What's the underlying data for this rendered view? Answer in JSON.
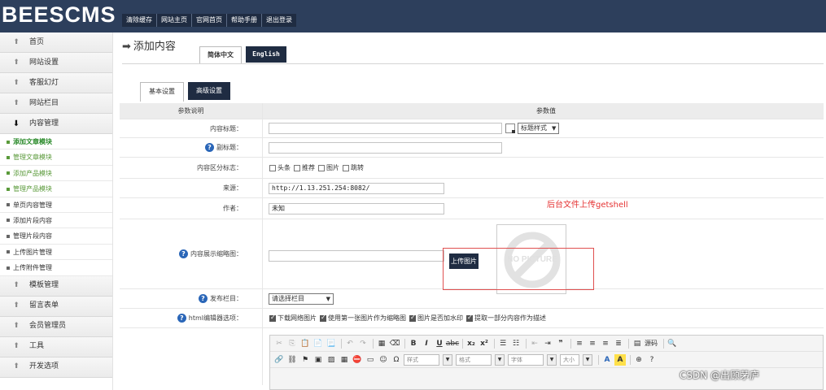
{
  "app": {
    "logo": "BEESCMS"
  },
  "topnav": [
    "清除缓存",
    "网站主页",
    "官网首页",
    "帮助手册",
    "退出登录"
  ],
  "sidebar": {
    "groups_top": [
      {
        "label": "首页",
        "icon": "up-arrow-icon"
      },
      {
        "label": "网站设置",
        "icon": "up-arrow-icon"
      },
      {
        "label": "客服幻灯",
        "icon": "up-arrow-icon"
      },
      {
        "label": "网站栏目",
        "icon": "up-arrow-icon"
      },
      {
        "label": "内容管理",
        "icon": "down-arrow-icon"
      }
    ],
    "subs": [
      "添加文章模块",
      "管理文章模块",
      "添加产品模块",
      "管理产品模块",
      "单页内容管理",
      "添加片段内容",
      "管理片段内容",
      "上传图片管理",
      "上传附件管理"
    ],
    "groups_bottom": [
      {
        "label": "模板管理",
        "icon": "up-arrow-icon"
      },
      {
        "label": "留言表单",
        "icon": "up-arrow-icon"
      },
      {
        "label": "会员管理员",
        "icon": "up-arrow-icon"
      },
      {
        "label": "工具",
        "icon": "up-arrow-icon"
      },
      {
        "label": "开发选项",
        "icon": "up-arrow-icon"
      }
    ]
  },
  "page": {
    "title": "添加内容",
    "lang_tabs": [
      "简体中文",
      "English"
    ],
    "setting_tabs": [
      "基本设置",
      "高级设置"
    ]
  },
  "form": {
    "header": {
      "param": "参数说明",
      "value": "参数值"
    },
    "title_label": "内容标题：",
    "title_style": "标题样式",
    "subtitle_label": "副标题：",
    "flags_label": "内容区分标志：",
    "flags": [
      "头条",
      "推荐",
      "图片",
      "跳转"
    ],
    "source_label": "来源：",
    "source_value": "http://1.13.251.254:8082/",
    "author_label": "作者：",
    "author_value": "未知",
    "thumb_label": "内容展示缩略图：",
    "upload_label": "上传图片",
    "nopic_text": "NO PICTURE",
    "category_label": "发布栏目：",
    "category_value": "请选择栏目",
    "editor_label": "html编辑器选项：",
    "editor_opts": [
      "下载网络图片",
      "使用第一张图片作为缩略图",
      "图片是否加水印",
      "提取一部分内容作为描述"
    ]
  },
  "editor": {
    "source_label": "源码",
    "combos": [
      "样式",
      "格式",
      "字体",
      "大小"
    ]
  },
  "annotation": "后台文件上传getshell",
  "watermark": "CSDN @出顾茅庐"
}
